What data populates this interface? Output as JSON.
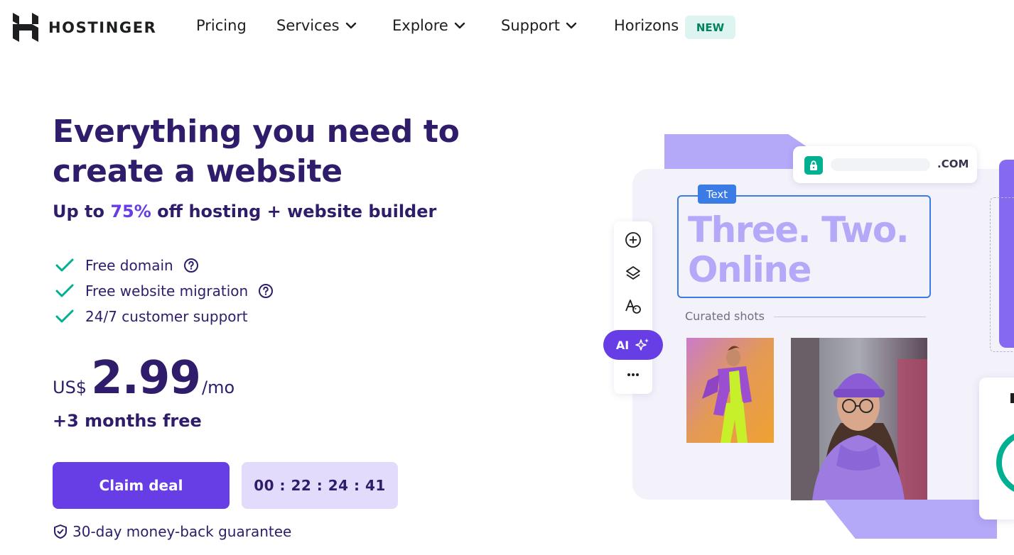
{
  "nav": {
    "brand": "HOSTINGER",
    "items": [
      {
        "label": "Pricing",
        "has_dropdown": false
      },
      {
        "label": "Services",
        "has_dropdown": true
      },
      {
        "label": "Explore",
        "has_dropdown": true
      },
      {
        "label": "Support",
        "has_dropdown": true
      },
      {
        "label": "Horizons",
        "has_dropdown": false
      }
    ],
    "new_badge": "NEW"
  },
  "hero": {
    "title": "Everything you need to create a website",
    "subtitle_prefix": "Up to ",
    "subtitle_percent": "75%",
    "subtitle_suffix": " off hosting + website builder",
    "features": [
      {
        "label": "Free domain",
        "has_help": true
      },
      {
        "label": "Free website migration",
        "has_help": true
      },
      {
        "label": "24/7 customer support",
        "has_help": false
      }
    ],
    "price": {
      "currency": "US$",
      "amount": "2.99",
      "period": "/mo"
    },
    "bonus": "+3 months free",
    "cta_label": "Claim deal",
    "timer": "00 : 22 : 24 : 41",
    "guarantee": "30-day money-back guarantee"
  },
  "illustration": {
    "url_tld": ".COM",
    "text_tag": "Text",
    "headline": "Three. Two. Online",
    "curated_label": "Curated shots",
    "ai_label": "AI",
    "toolbar_icons": [
      "add-icon",
      "layers-icon",
      "font-style-icon",
      "more-icon"
    ]
  },
  "colors": {
    "primary": "#673de6",
    "heading": "#2f1c6a",
    "success": "#00b090",
    "accent_light": "#b4a8f8",
    "timer_bg": "#e2dbfb",
    "badge_bg": "#def4f0",
    "badge_text": "#008361"
  }
}
